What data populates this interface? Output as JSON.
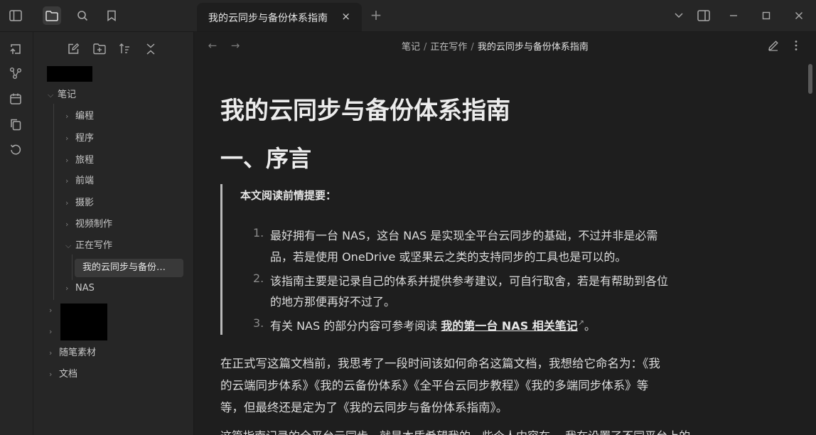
{
  "tabs": {
    "active_title": "我的云同步与备份体系指南",
    "close": "×",
    "new_tab": "+"
  },
  "breadcrumb": [
    "笔记",
    "正在写作",
    "我的云同步与备份体系指南"
  ],
  "breadcrumb_sep": "/",
  "tree": {
    "root": "笔记",
    "children": [
      "编程",
      "程序",
      "旅程",
      "前端",
      "摄影",
      "视频制作",
      "正在写作"
    ],
    "active_file": "我的云同步与备份…",
    "nas": "NAS",
    "others": [
      "随笔素材",
      "文档"
    ]
  },
  "doc": {
    "title": "我的云同步与备份体系指南",
    "h2": "一、序言",
    "quote_title": "本文阅读前情提要：",
    "list": [
      {
        "num": "1.",
        "lines": [
          "最好拥有一台 NAS，这台 NAS 是实现全平台云同步的基础，不过并非是必需",
          "品，若是使用 OneDrive 或坚果云之类的支持同步的工具也是可以的。"
        ]
      },
      {
        "num": "2.",
        "lines": [
          "该指南主要是记录自己的体系并提供参考建议，可自行取舍，若是有帮助到各位",
          "的地方那便再好不过了。"
        ]
      },
      {
        "num": "3.",
        "prefix": "有关 NAS 的部分内容可参考阅读 ",
        "link": "我的第一台 NAS 相关笔记",
        "suffix": "。"
      }
    ],
    "paragraph": [
      "在正式写这篇文档前，我思考了一段时间该如何命名这篇文档，我想给它命名为：《我",
      "的云端同步体系》《我的云备份体系》《全平台云同步教程》《我的多端同步体系》等",
      "等，但最终还是定为了《我的云同步与备份体系指南》。"
    ],
    "cut_line": "这篇指南记录的全平台云同步，就是本质希望我的一些个人内容在… 我在设置了不同平台上的"
  }
}
